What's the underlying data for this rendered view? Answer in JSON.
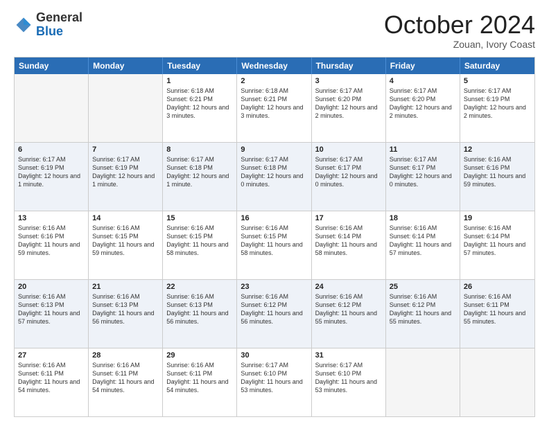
{
  "logo": {
    "general": "General",
    "blue": "Blue"
  },
  "title": "October 2024",
  "location": "Zouan, Ivory Coast",
  "days": [
    "Sunday",
    "Monday",
    "Tuesday",
    "Wednesday",
    "Thursday",
    "Friday",
    "Saturday"
  ],
  "rows": [
    [
      {
        "day": "",
        "info": "",
        "empty": true
      },
      {
        "day": "",
        "info": "",
        "empty": true
      },
      {
        "day": "1",
        "info": "Sunrise: 6:18 AM\nSunset: 6:21 PM\nDaylight: 12 hours and 3 minutes."
      },
      {
        "day": "2",
        "info": "Sunrise: 6:18 AM\nSunset: 6:21 PM\nDaylight: 12 hours and 3 minutes."
      },
      {
        "day": "3",
        "info": "Sunrise: 6:17 AM\nSunset: 6:20 PM\nDaylight: 12 hours and 2 minutes."
      },
      {
        "day": "4",
        "info": "Sunrise: 6:17 AM\nSunset: 6:20 PM\nDaylight: 12 hours and 2 minutes."
      },
      {
        "day": "5",
        "info": "Sunrise: 6:17 AM\nSunset: 6:19 PM\nDaylight: 12 hours and 2 minutes."
      }
    ],
    [
      {
        "day": "6",
        "info": "Sunrise: 6:17 AM\nSunset: 6:19 PM\nDaylight: 12 hours and 1 minute."
      },
      {
        "day": "7",
        "info": "Sunrise: 6:17 AM\nSunset: 6:19 PM\nDaylight: 12 hours and 1 minute."
      },
      {
        "day": "8",
        "info": "Sunrise: 6:17 AM\nSunset: 6:18 PM\nDaylight: 12 hours and 1 minute."
      },
      {
        "day": "9",
        "info": "Sunrise: 6:17 AM\nSunset: 6:18 PM\nDaylight: 12 hours and 0 minutes."
      },
      {
        "day": "10",
        "info": "Sunrise: 6:17 AM\nSunset: 6:17 PM\nDaylight: 12 hours and 0 minutes."
      },
      {
        "day": "11",
        "info": "Sunrise: 6:17 AM\nSunset: 6:17 PM\nDaylight: 12 hours and 0 minutes."
      },
      {
        "day": "12",
        "info": "Sunrise: 6:16 AM\nSunset: 6:16 PM\nDaylight: 11 hours and 59 minutes."
      }
    ],
    [
      {
        "day": "13",
        "info": "Sunrise: 6:16 AM\nSunset: 6:16 PM\nDaylight: 11 hours and 59 minutes."
      },
      {
        "day": "14",
        "info": "Sunrise: 6:16 AM\nSunset: 6:15 PM\nDaylight: 11 hours and 59 minutes."
      },
      {
        "day": "15",
        "info": "Sunrise: 6:16 AM\nSunset: 6:15 PM\nDaylight: 11 hours and 58 minutes."
      },
      {
        "day": "16",
        "info": "Sunrise: 6:16 AM\nSunset: 6:15 PM\nDaylight: 11 hours and 58 minutes."
      },
      {
        "day": "17",
        "info": "Sunrise: 6:16 AM\nSunset: 6:14 PM\nDaylight: 11 hours and 58 minutes."
      },
      {
        "day": "18",
        "info": "Sunrise: 6:16 AM\nSunset: 6:14 PM\nDaylight: 11 hours and 57 minutes."
      },
      {
        "day": "19",
        "info": "Sunrise: 6:16 AM\nSunset: 6:14 PM\nDaylight: 11 hours and 57 minutes."
      }
    ],
    [
      {
        "day": "20",
        "info": "Sunrise: 6:16 AM\nSunset: 6:13 PM\nDaylight: 11 hours and 57 minutes."
      },
      {
        "day": "21",
        "info": "Sunrise: 6:16 AM\nSunset: 6:13 PM\nDaylight: 11 hours and 56 minutes."
      },
      {
        "day": "22",
        "info": "Sunrise: 6:16 AM\nSunset: 6:13 PM\nDaylight: 11 hours and 56 minutes."
      },
      {
        "day": "23",
        "info": "Sunrise: 6:16 AM\nSunset: 6:12 PM\nDaylight: 11 hours and 56 minutes."
      },
      {
        "day": "24",
        "info": "Sunrise: 6:16 AM\nSunset: 6:12 PM\nDaylight: 11 hours and 55 minutes."
      },
      {
        "day": "25",
        "info": "Sunrise: 6:16 AM\nSunset: 6:12 PM\nDaylight: 11 hours and 55 minutes."
      },
      {
        "day": "26",
        "info": "Sunrise: 6:16 AM\nSunset: 6:11 PM\nDaylight: 11 hours and 55 minutes."
      }
    ],
    [
      {
        "day": "27",
        "info": "Sunrise: 6:16 AM\nSunset: 6:11 PM\nDaylight: 11 hours and 54 minutes."
      },
      {
        "day": "28",
        "info": "Sunrise: 6:16 AM\nSunset: 6:11 PM\nDaylight: 11 hours and 54 minutes."
      },
      {
        "day": "29",
        "info": "Sunrise: 6:16 AM\nSunset: 6:11 PM\nDaylight: 11 hours and 54 minutes."
      },
      {
        "day": "30",
        "info": "Sunrise: 6:17 AM\nSunset: 6:10 PM\nDaylight: 11 hours and 53 minutes."
      },
      {
        "day": "31",
        "info": "Sunrise: 6:17 AM\nSunset: 6:10 PM\nDaylight: 11 hours and 53 minutes."
      },
      {
        "day": "",
        "info": "",
        "empty": true
      },
      {
        "day": "",
        "info": "",
        "empty": true
      }
    ]
  ]
}
